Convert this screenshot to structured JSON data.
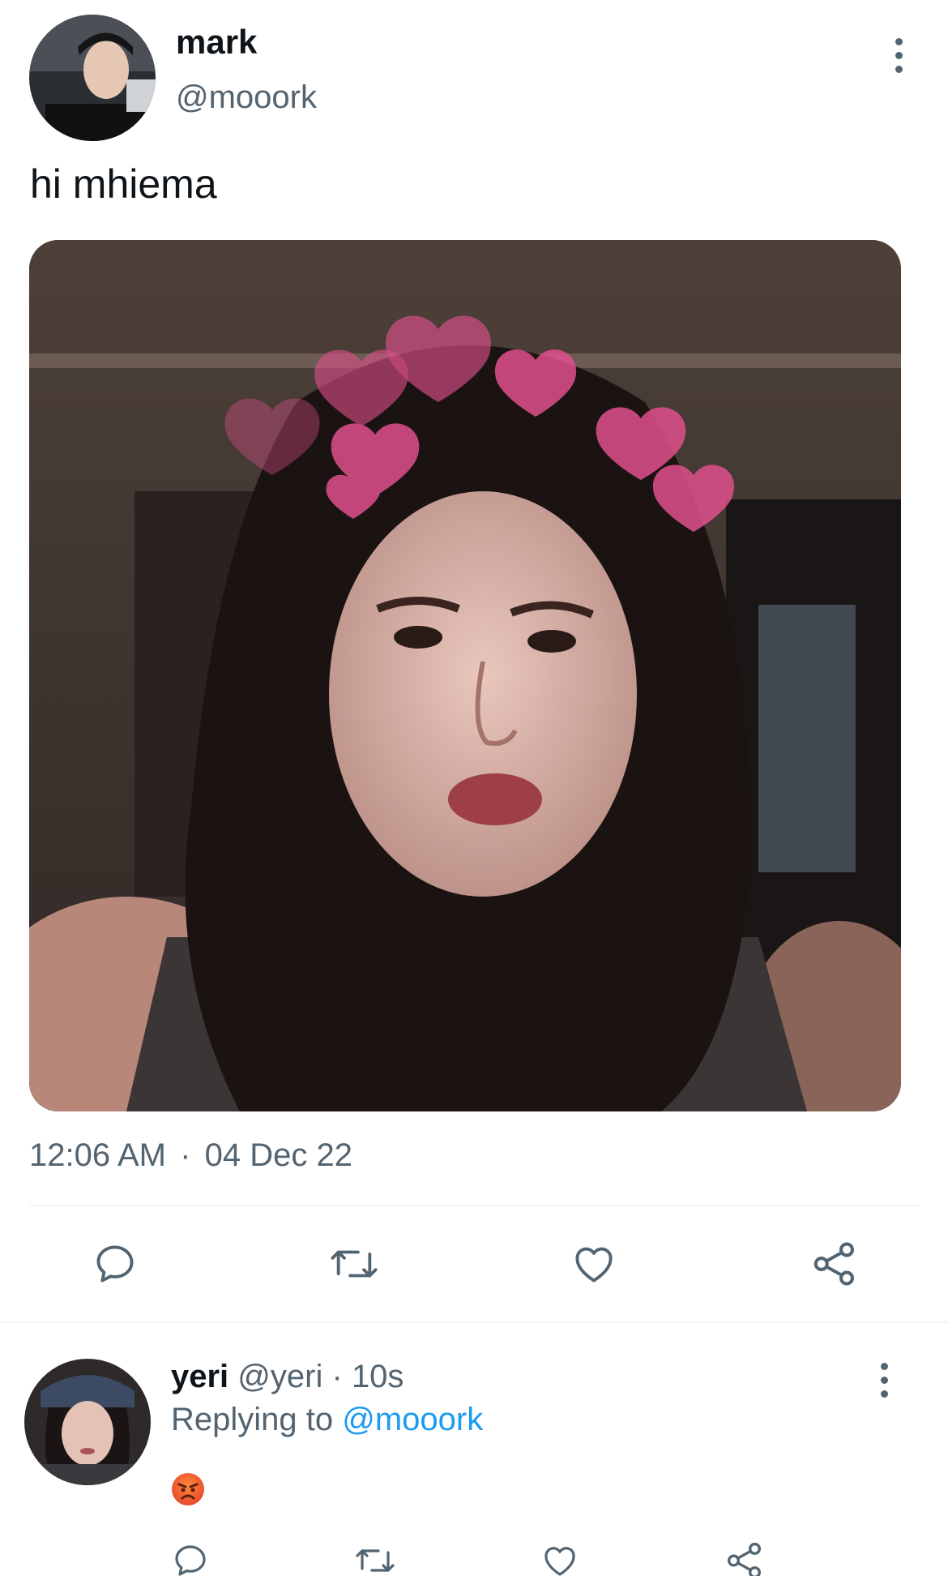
{
  "post": {
    "author_name": "mark",
    "author_handle": "@mooork",
    "text": "hi mhiema",
    "time": "12:06 AM",
    "separator": "·",
    "date": "04 Dec 22",
    "media_overlay": "pink hearts filter"
  },
  "reply": {
    "author_name": "yeri",
    "author_handle": "@yeri",
    "separator": "·",
    "age": "10s",
    "replying_prefix": "Replying to",
    "replying_handle": "@mooork",
    "emoji_icon": "angry-face-emoji"
  },
  "icons": {
    "reply": "comment-bubble-icon",
    "retweet": "retweet-icon",
    "like": "heart-icon",
    "share": "share-icon",
    "more": "more-vertical-icon"
  },
  "colors": {
    "text_primary": "#0f1419",
    "text_secondary": "#536471",
    "link": "#1d9bf0",
    "icon": "#536471",
    "divider": "#eff3f4",
    "heart_overlay": "#e0508c"
  }
}
